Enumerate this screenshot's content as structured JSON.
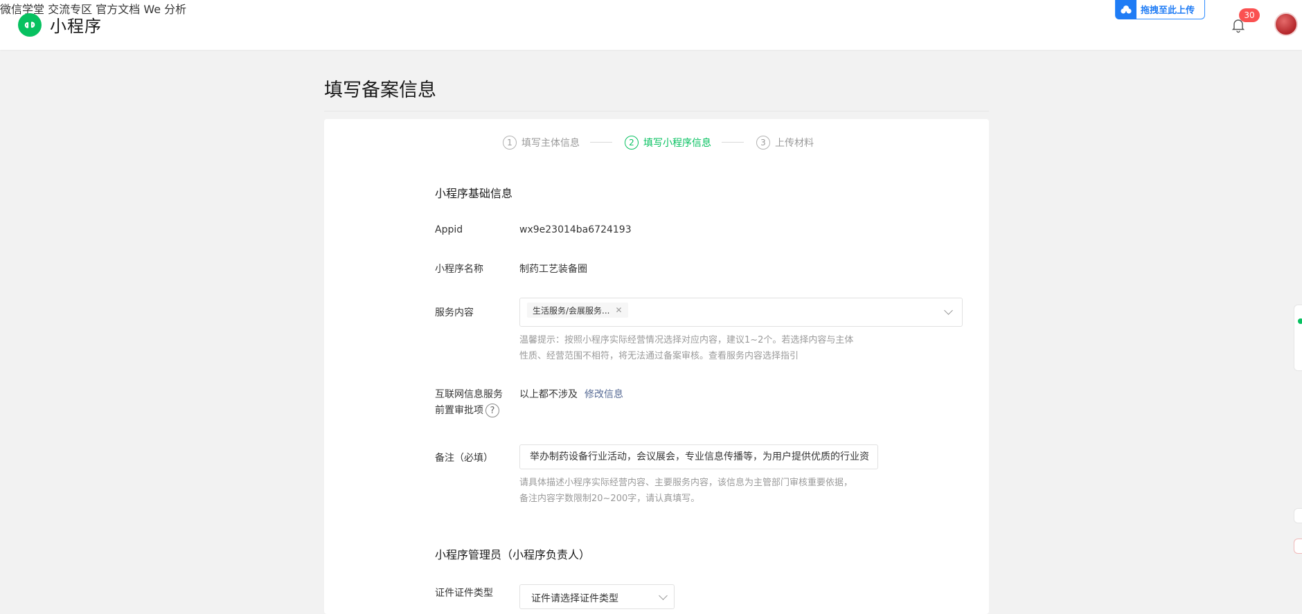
{
  "header": {
    "app_name": "小程序",
    "nav": [
      {
        "label": "微信学堂"
      },
      {
        "label": "交流专区"
      },
      {
        "label": "官方文档"
      },
      {
        "label": "We 分析"
      }
    ],
    "notification_count": "30",
    "upload_widget_label": "拖拽至此上传",
    "brand_color": "#07c160"
  },
  "page": {
    "title": "填写备案信息"
  },
  "stepper": {
    "steps": [
      {
        "num": "1",
        "label": "填写主体信息",
        "state": "done"
      },
      {
        "num": "2",
        "label": "填写小程序信息",
        "state": "active"
      },
      {
        "num": "3",
        "label": "上传材料",
        "state": "pending"
      }
    ]
  },
  "basic_info": {
    "section_title": "小程序基础信息",
    "appid_label": "Appid",
    "appid_value": "wx9e23014ba6724193",
    "name_label": "小程序名称",
    "name_value": "制药工艺装备圈",
    "service_label": "服务内容",
    "service_tags": [
      "生活服务/会展服务..."
    ],
    "service_hint_line1": "温馨提示：按照小程序实际经营情况选择对应内容，建议1~2个。若选择内容与主体",
    "service_hint_line2": "性质、经营范围不相符，将无法通过备案审核。查看服务内容选择指引",
    "internet_label_line1": "互联网信息服务",
    "internet_label_line2": "前置审批项",
    "internet_help": "?",
    "internet_value": "以上都不涉及",
    "internet_edit_link": "修改信息",
    "remark_label": "备注（必填）",
    "remark_value": "举办制药设备行业活动，会议展会，专业信息传播等，为用户提供优质的行业资",
    "remark_hint_line1": "请具体描述小程序实际经营内容、主要服务内容，该信息为主管部门审核重要依据，",
    "remark_hint_line2": "备注内容字数限制20~200字，请认真填写。"
  },
  "admin_info": {
    "section_title": "小程序管理员（小程序负责人）",
    "id_type_label": "证件证件类型",
    "id_type_value": "证件请选择证件类型"
  }
}
